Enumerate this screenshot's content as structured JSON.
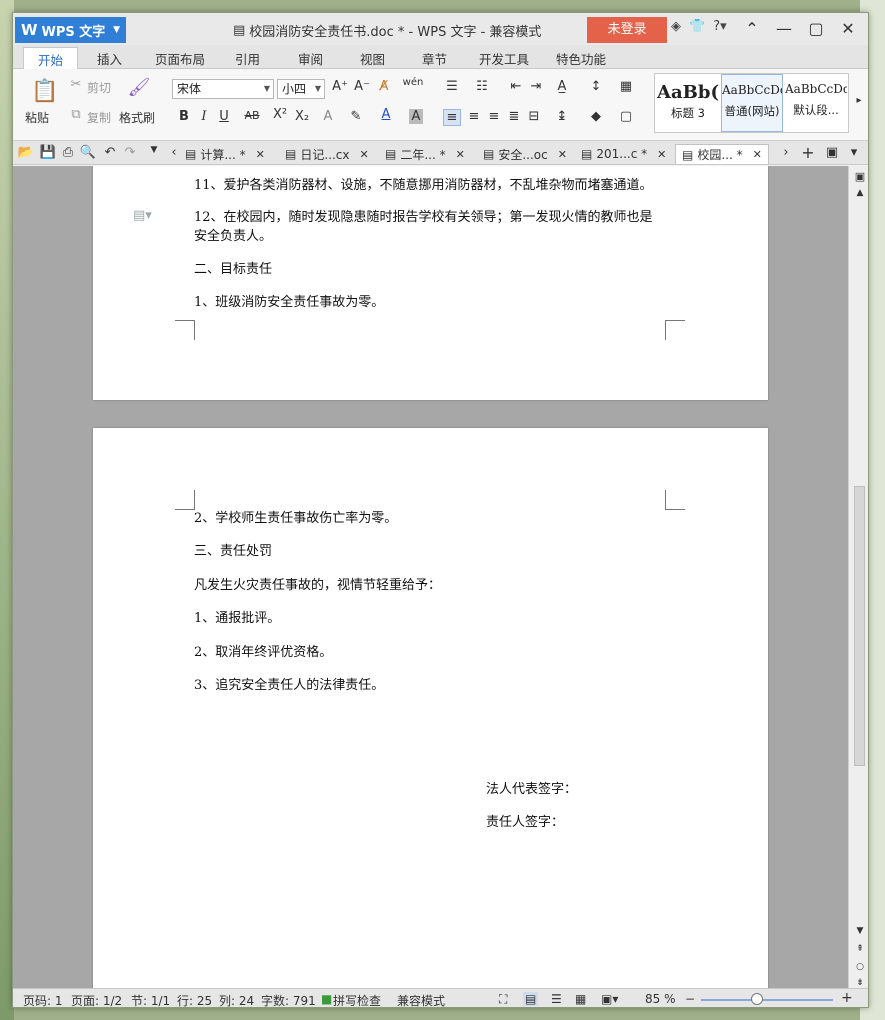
{
  "app": {
    "name": "WPS 文字",
    "title": "校园消防安全责任书.doc * - WPS 文字 - 兼容模式",
    "login": "未登录"
  },
  "ribbon_tabs": [
    "开始",
    "插入",
    "页面布局",
    "引用",
    "审阅",
    "视图",
    "章节",
    "开发工具",
    "特色功能"
  ],
  "ribbon": {
    "paste": "粘贴",
    "cut": "剪切",
    "copy": "复制",
    "format_painter": "格式刷",
    "font_name": "宋体",
    "font_size": "小四",
    "styles": [
      {
        "sample": "AaBb(",
        "label": "标题 3"
      },
      {
        "sample": "AaBbCcDd",
        "label": "普通(网站)"
      },
      {
        "sample": "AaBbCcDd",
        "label": "默认段..."
      }
    ]
  },
  "doc_tabs": [
    {
      "label": "计算... *"
    },
    {
      "label": "日记...cx"
    },
    {
      "label": "二年... *"
    },
    {
      "label": "安全...oc"
    },
    {
      "label": "201...c *"
    },
    {
      "label": "校园... *"
    }
  ],
  "page1": {
    "lines": [
      "11、爱护各类消防器材、设施，不随意挪用消防器材，不乱堆杂物而堵塞通道。",
      "12、在校园内，随时发现隐患随时报告学校有关领导；第一发现火情的教师也是",
      "安全负责人。",
      "二、目标责任",
      "1、班级消防安全责任事故为零。"
    ]
  },
  "page2": {
    "lines": [
      "2、学校师生责任事故伤亡率为零。",
      "三、责任处罚",
      "凡发生火灾责任事故的，视情节轻重给予：",
      "1、通报批评。",
      "2、取消年终评优资格。",
      "3、追究安全责任人的法律责任。"
    ],
    "signatures": [
      "法人代表签字：",
      "责任人签字："
    ]
  },
  "status": {
    "page_code": "页码: 1",
    "pages": "页面: 1/2",
    "section": "节: 1/1",
    "row": "行: 25",
    "col": "列: 24",
    "words": "字数: 791",
    "spell": "拼写检查",
    "mode": "兼容模式",
    "zoom": "85 %"
  }
}
